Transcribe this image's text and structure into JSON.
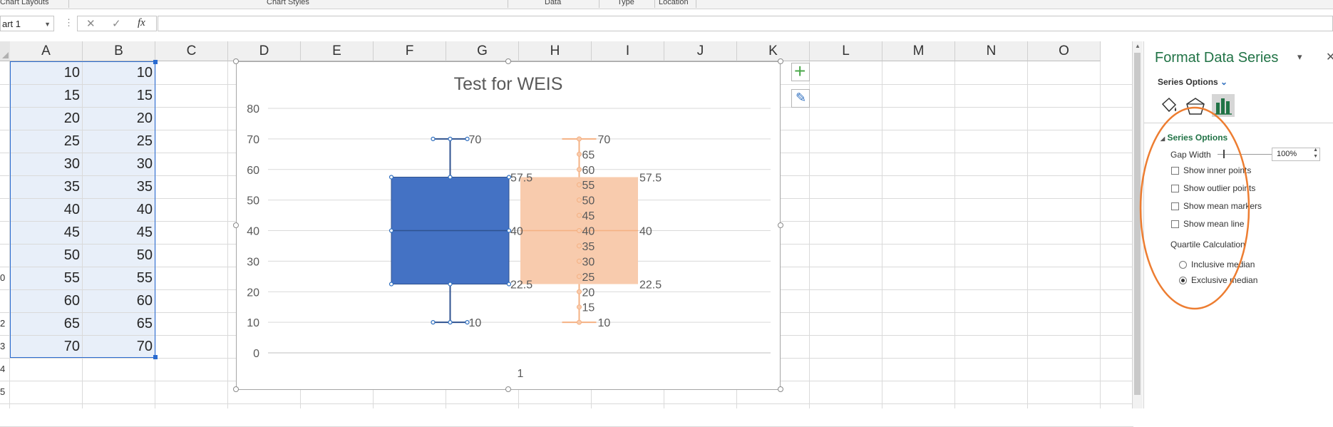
{
  "ribbon": {
    "groups": [
      "Chart Layouts",
      "Chart Styles",
      "Data",
      "Type",
      "Location"
    ]
  },
  "formula_bar": {
    "name_box": "art 1",
    "cancel_glyph": "✕",
    "enter_glyph": "✓",
    "fx_label": "fx",
    "formula_value": ""
  },
  "sheet": {
    "columns": [
      "A",
      "B",
      "C",
      "D",
      "E",
      "F",
      "G",
      "H",
      "I",
      "J",
      "K",
      "L",
      "M",
      "N",
      "O"
    ],
    "row_headers_visible": [
      "",
      "",
      "",
      "",
      "",
      "",
      "",
      "",
      "",
      "0",
      "",
      "2",
      "3",
      "4",
      "5"
    ],
    "col_a": [
      "10",
      "15",
      "20",
      "25",
      "30",
      "35",
      "40",
      "45",
      "50",
      "55",
      "60",
      "65",
      "70"
    ],
    "col_b": [
      "10",
      "15",
      "20",
      "25",
      "30",
      "35",
      "40",
      "45",
      "50",
      "55",
      "60",
      "65",
      "70"
    ]
  },
  "chart_data": {
    "type": "box",
    "title": "Test for WEIS",
    "ylim": [
      0,
      80
    ],
    "yticks": [
      "0",
      "10",
      "20",
      "30",
      "40",
      "50",
      "60",
      "70",
      "80"
    ],
    "categories": [
      "1"
    ],
    "grid": true,
    "series": [
      {
        "color": "#4472c4",
        "min": 10,
        "q1": 22.5,
        "median": 40,
        "q3": 57.5,
        "max": 70,
        "labels": [
          "70",
          "57.5",
          "40",
          "22.5",
          "10"
        ]
      },
      {
        "color": "#f8cbad",
        "min": 10,
        "q1": 22.5,
        "median": 40,
        "q3": 57.5,
        "max": 70,
        "points": [
          10,
          15,
          20,
          25,
          30,
          35,
          40,
          45,
          50,
          55,
          60,
          65,
          70
        ],
        "point_labels": [
          "15",
          "20",
          "25",
          "30",
          "35",
          "40",
          "45",
          "50",
          "55",
          "60",
          "65"
        ],
        "labels": [
          "70",
          "57.5",
          "40",
          "22.5",
          "10"
        ]
      }
    ]
  },
  "chart_buttons": {
    "add_glyph": "+",
    "style_glyph": "✎"
  },
  "panel": {
    "title": "Format Data Series",
    "dropdown_glyph": "▾",
    "close_glyph": "✕",
    "subtitle": "Series Options",
    "section": "Series Options",
    "gap_width_label": "Gap Width",
    "gap_width_value": "100%",
    "gap_width_fraction": 0.0,
    "options": [
      {
        "label": "Show inner points",
        "checked": false
      },
      {
        "label": "Show outlier points",
        "checked": false
      },
      {
        "label": "Show mean markers",
        "checked": false
      },
      {
        "label": "Show mean line",
        "checked": false
      }
    ],
    "quartile_label": "Quartile Calculation",
    "quartile_options": [
      {
        "label": "Inclusive median",
        "selected": false
      },
      {
        "label": "Exclusive median",
        "selected": true
      }
    ]
  },
  "colors": {
    "accent": "#217346",
    "annotation": "#ed7d31",
    "selection": "#2a6bd0"
  }
}
